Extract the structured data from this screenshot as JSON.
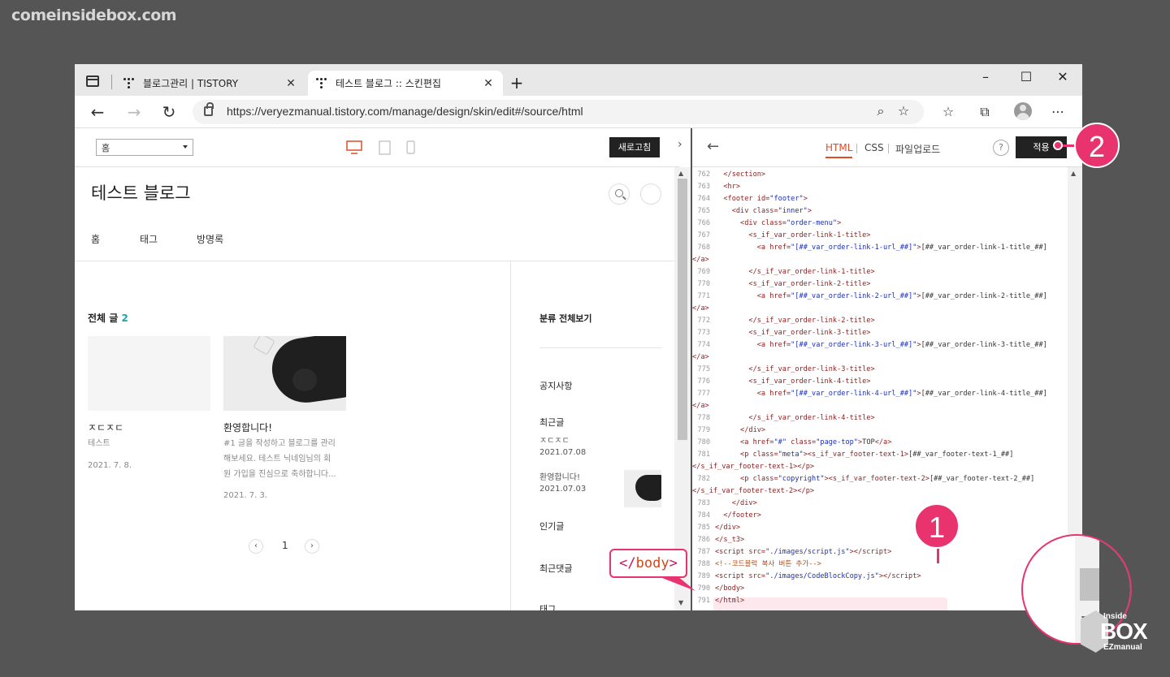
{
  "watermark": "comeinsidebox.com",
  "browser": {
    "tabs": [
      {
        "label": "블로그관리 | TISTORY",
        "active": false
      },
      {
        "label": "테스트 블로그 :: 스킨편집",
        "active": true
      }
    ],
    "url": "https://veryezmanual.tistory.com/manage/design/skin/edit#/source/html"
  },
  "preview": {
    "select_value": "홈",
    "refresh_label": "새로고침",
    "blog_title": "테스트 블로그",
    "nav": [
      "홈",
      "태그",
      "방명록"
    ],
    "total_label": "전체 글",
    "total_count": "2",
    "posts": [
      {
        "title": "ㅈㄷㅈㄷ",
        "text": "테스트",
        "date": "2021. 7. 8."
      },
      {
        "title": "환영합니다!",
        "text1": "#1 글을 작성하고 블로그를 관리",
        "text2": "해보세요. 테스트 닉네임님의 회",
        "text3": "원 가입을 진심으로 축하합니다...",
        "date": "2021. 7. 3."
      }
    ],
    "page": "1",
    "sidebar": {
      "category": "분류 전체보기",
      "notice": "공지사항",
      "recent": "최근글",
      "recent_items": [
        {
          "title": "ㅈㄷㅈㄷ",
          "date": "2021.07.08"
        },
        {
          "title": "환영합니다!",
          "date": "2021.07.03"
        }
      ],
      "popular": "인기글",
      "comments": "최근댓글",
      "tags": "태그"
    }
  },
  "editor": {
    "tabs": [
      "HTML",
      "CSS",
      "파일업로드"
    ],
    "help": "?",
    "apply_label": "적용"
  },
  "annotations": {
    "badge1": "1",
    "badge2": "2",
    "callout_lt": "</",
    "callout_name": "body",
    "callout_gt": ">"
  },
  "logo": {
    "top": "Inside",
    "main": "BOX",
    "sub": "EZmanual"
  },
  "colors": {
    "accent": "#e8336f",
    "html_tab": "#e04a2a",
    "count": "#1ea6a6"
  }
}
